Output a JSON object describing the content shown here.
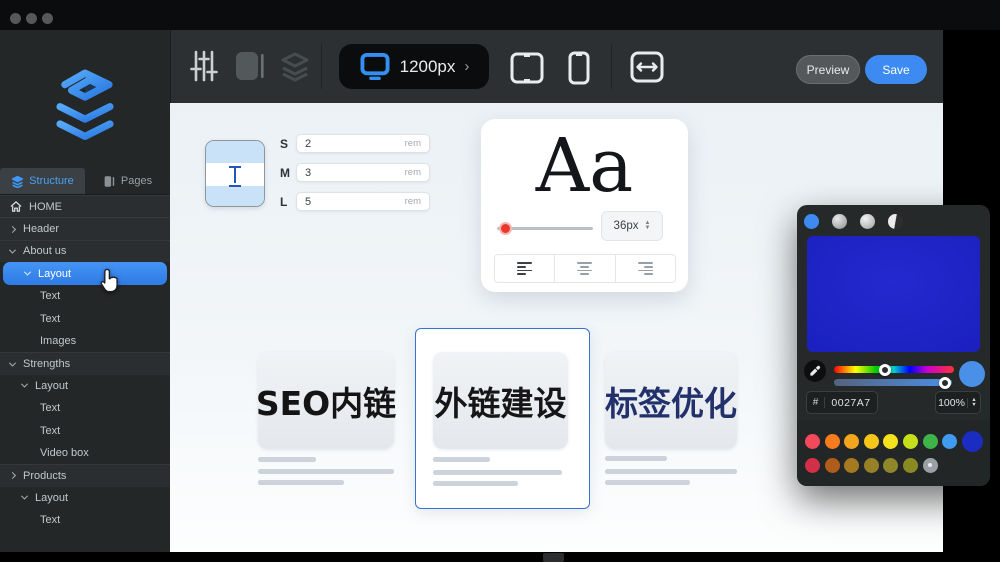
{
  "sidebar": {
    "tabs": [
      {
        "label": "Structure",
        "active": true
      },
      {
        "label": "Pages",
        "active": false
      }
    ],
    "tree": [
      {
        "label": "HOME",
        "level": 0,
        "icon": "home"
      },
      {
        "label": "Header",
        "level": 0,
        "expanded": false
      },
      {
        "label": "About us",
        "level": 0,
        "expanded": true
      },
      {
        "label": "Layout",
        "level": 1,
        "expanded": true,
        "selected": true
      },
      {
        "label": "Text",
        "level": 2
      },
      {
        "label": "Text",
        "level": 2
      },
      {
        "label": "Images",
        "level": 2
      },
      {
        "label": "Strengths",
        "level": 0,
        "expanded": true
      },
      {
        "label": "Layout",
        "level": 1,
        "expanded": true
      },
      {
        "label": "Text",
        "level": 2
      },
      {
        "label": "Text",
        "level": 2
      },
      {
        "label": "Video box",
        "level": 2
      },
      {
        "label": "Products",
        "level": 0,
        "expanded": false
      },
      {
        "label": "Layout",
        "level": 1,
        "expanded": true
      },
      {
        "label": "Text",
        "level": 2
      }
    ]
  },
  "toolbar": {
    "viewport": {
      "value": "1200px",
      "chevron": "›"
    },
    "preview_label": "Preview",
    "save_label": "Save"
  },
  "canvas": {
    "spacing": {
      "rows": [
        {
          "label": "S",
          "value": "2",
          "unit": "rem"
        },
        {
          "label": "M",
          "value": "3",
          "unit": "rem"
        },
        {
          "label": "L",
          "value": "5",
          "unit": "rem"
        }
      ]
    },
    "typography": {
      "sample": "Aa",
      "font_size": "36px"
    },
    "cards": [
      {
        "title": "SEO内链",
        "title_color": "#141414",
        "selected": false
      },
      {
        "title": "外链建设",
        "title_color": "#161616",
        "selected": true
      },
      {
        "title": "标签优化",
        "title_color": "#22306b",
        "selected": false
      }
    ]
  },
  "color_picker": {
    "hex_prefix": "#",
    "hex": "0027A7",
    "opacity": "100%",
    "current_color": "#4a90e8",
    "selected_swatch_index": "8",
    "row2_dot_index": "6",
    "swatches_row1": [
      "#f4495a",
      "#f87c1e",
      "#f2a51d",
      "#f6c51a",
      "#f6e11e",
      "#c6df1b",
      "#3fb347",
      "#3f9bf0",
      "#1b2cc1"
    ],
    "swatches_row2": [
      "#d22f48",
      "#b05c1a",
      "#a4791f",
      "#968126",
      "#90862a",
      "#8a8a22",
      "#9aa0a6"
    ],
    "accent": "#3d8bf2"
  }
}
